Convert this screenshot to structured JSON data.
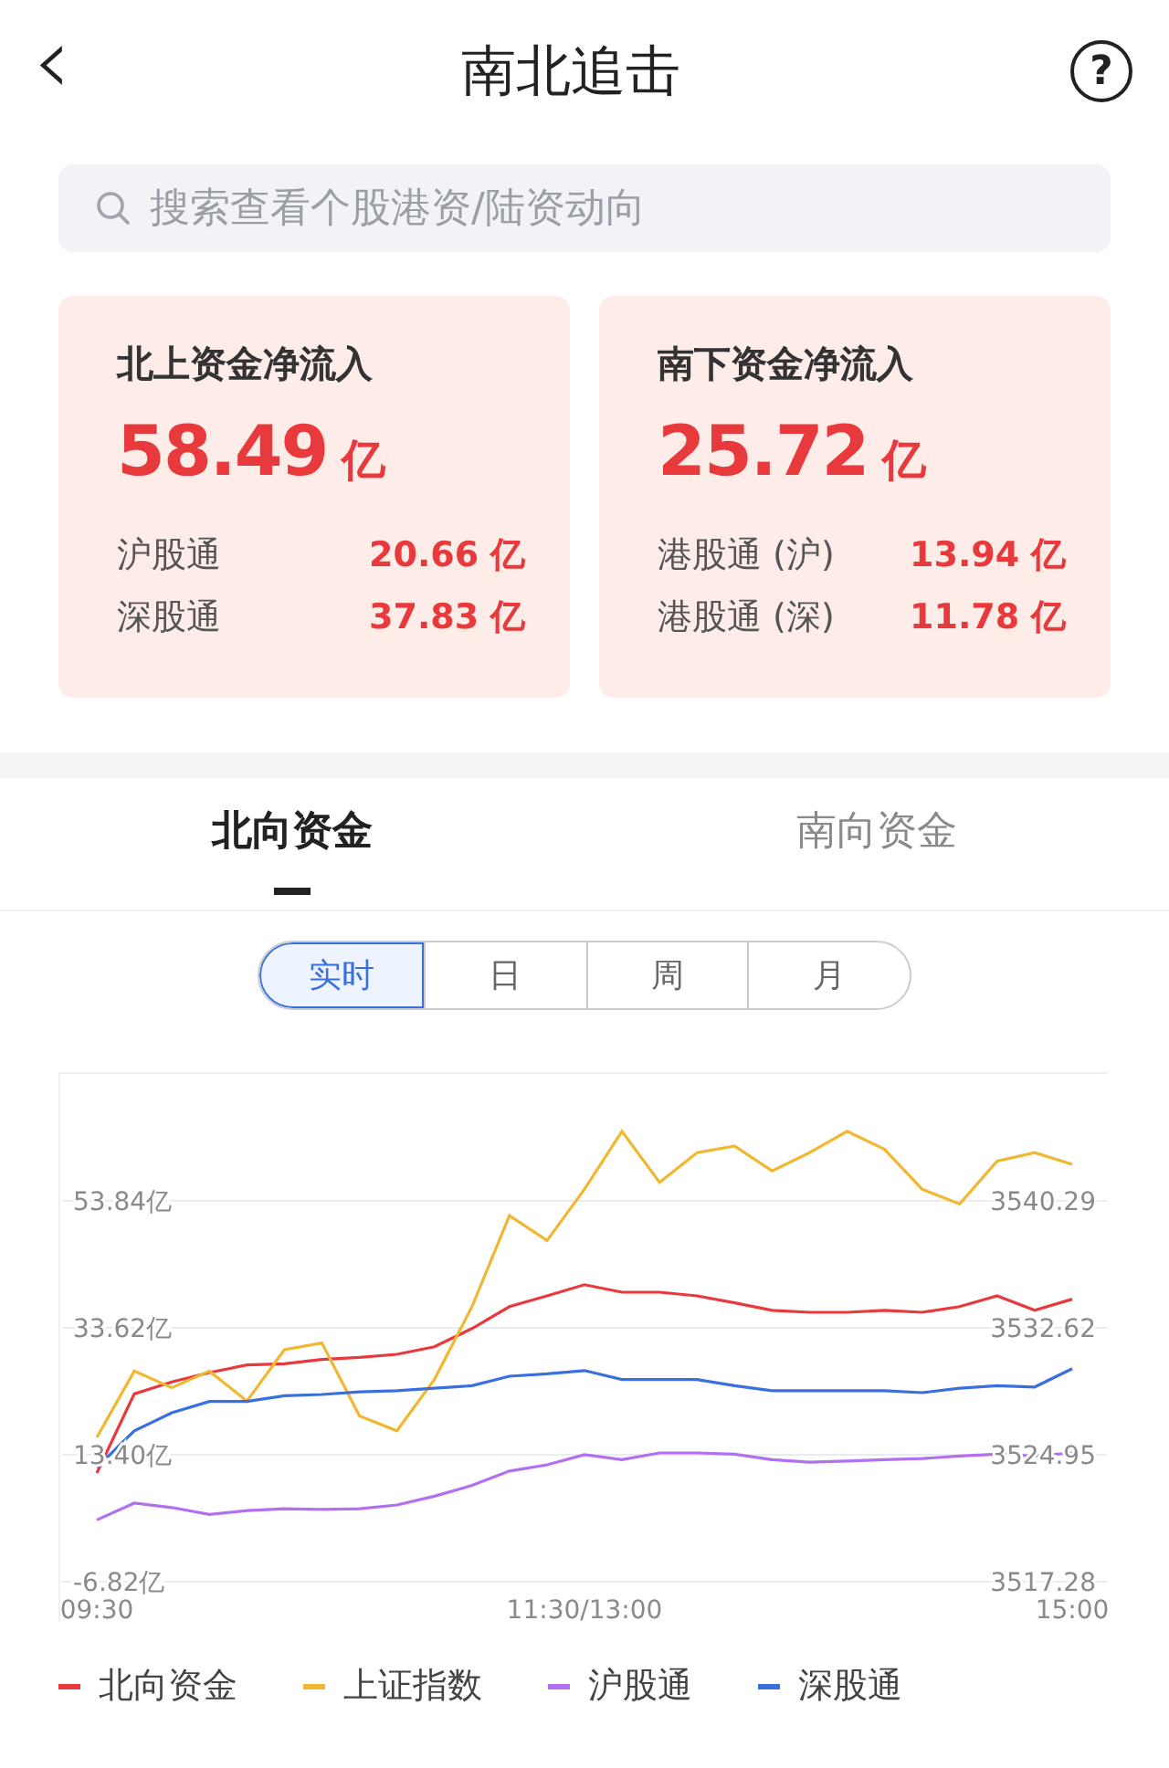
{
  "header": {
    "back": "‹",
    "title": "南北追击",
    "help": "?"
  },
  "search": {
    "placeholder": "搜索查看个股港资/陆资动向"
  },
  "cards": [
    {
      "title": "北上资金净流入",
      "amount": "58.49",
      "unit": "亿",
      "rows": [
        {
          "label": "沪股通",
          "value": "20.66 亿"
        },
        {
          "label": "深股通",
          "value": "37.83 亿"
        }
      ]
    },
    {
      "title": "南下资金净流入",
      "amount": "25.72",
      "unit": "亿",
      "rows": [
        {
          "label": "港股通 (沪)",
          "value": "13.94 亿"
        },
        {
          "label": "港股通 (深)",
          "value": "11.78 亿"
        }
      ]
    }
  ],
  "tabs": [
    {
      "label": "北向资金",
      "selected": true
    },
    {
      "label": "南向资金",
      "selected": false
    }
  ],
  "periods": [
    {
      "label": "实时",
      "selected": true
    },
    {
      "label": "日",
      "selected": false
    },
    {
      "label": "周",
      "selected": false
    },
    {
      "label": "月",
      "selected": false
    }
  ],
  "chart_data": {
    "type": "line",
    "grid": true,
    "categories": [
      "09:30",
      null,
      null,
      null,
      null,
      null,
      null,
      null,
      null,
      null,
      null,
      null,
      null,
      "11:30/13:00",
      null,
      null,
      null,
      null,
      null,
      null,
      null,
      null,
      null,
      null,
      null,
      null,
      "15:00"
    ],
    "ylim": [
      -6.82,
      74.06
    ],
    "yticks": [
      {
        "value": -6.82,
        "label": "-6.82亿"
      },
      {
        "value": 13.4,
        "label": "13.40亿"
      },
      {
        "value": 33.62,
        "label": "33.62亿"
      },
      {
        "value": 53.84,
        "label": "53.84亿"
      }
    ],
    "y2lim": [
      3517.28,
      3547.96
    ],
    "y2ticks": [
      {
        "value": 3517.28,
        "label": "3517.28"
      },
      {
        "value": 3524.95,
        "label": "3524.95"
      },
      {
        "value": 3532.62,
        "label": "3532.62"
      },
      {
        "value": 3540.29,
        "label": "3540.29"
      }
    ],
    "series": [
      {
        "name": "北向资金",
        "color": "#e8393c",
        "values": [
          10.5,
          23.1,
          25.0,
          26.5,
          27.7,
          27.9,
          28.6,
          28.9,
          29.4,
          30.6,
          33.5,
          37.0,
          38.7,
          40.5,
          39.3,
          39.3,
          38.7,
          37.6,
          36.4,
          36.1,
          36.1,
          36.4,
          36.1,
          37.0,
          38.7,
          36.4,
          38.2
        ]
      },
      {
        "name": "上证指数",
        "color": "#f2b731",
        "axis": "y2",
        "values": [
          3526,
          3530,
          3529,
          3530,
          3528.2,
          3531.3,
          3531.7,
          3527.3,
          3526.4,
          3529.5,
          3533.9,
          3539.4,
          3537.9,
          3541.0,
          3544.5,
          3541.4,
          3543.2,
          3543.6,
          3542.1,
          3543.2,
          3544.5,
          3543.4,
          3541.0,
          3540.1,
          3542.7,
          3543.2,
          3542.5
        ]
      },
      {
        "name": "沪股通",
        "color": "#b26ff0",
        "values": [
          3.0,
          5.7,
          5.0,
          3.9,
          4.5,
          4.8,
          4.7,
          4.8,
          5.4,
          6.8,
          8.5,
          10.8,
          11.8,
          13.4,
          12.6,
          13.7,
          13.7,
          13.5,
          12.6,
          12.2,
          12.4,
          12.6,
          12.8,
          13.2,
          13.5,
          13.2,
          13.7
        ]
      },
      {
        "name": "深股通",
        "color": "#3a6fe0",
        "values": [
          11.4,
          17.2,
          20.1,
          21.9,
          21.9,
          22.8,
          23.0,
          23.4,
          23.6,
          24.0,
          24.4,
          25.9,
          26.3,
          26.8,
          25.4,
          25.4,
          25.4,
          24.4,
          23.6,
          23.6,
          23.6,
          23.6,
          23.3,
          24.0,
          24.4,
          24.2,
          27.1
        ]
      }
    ]
  }
}
